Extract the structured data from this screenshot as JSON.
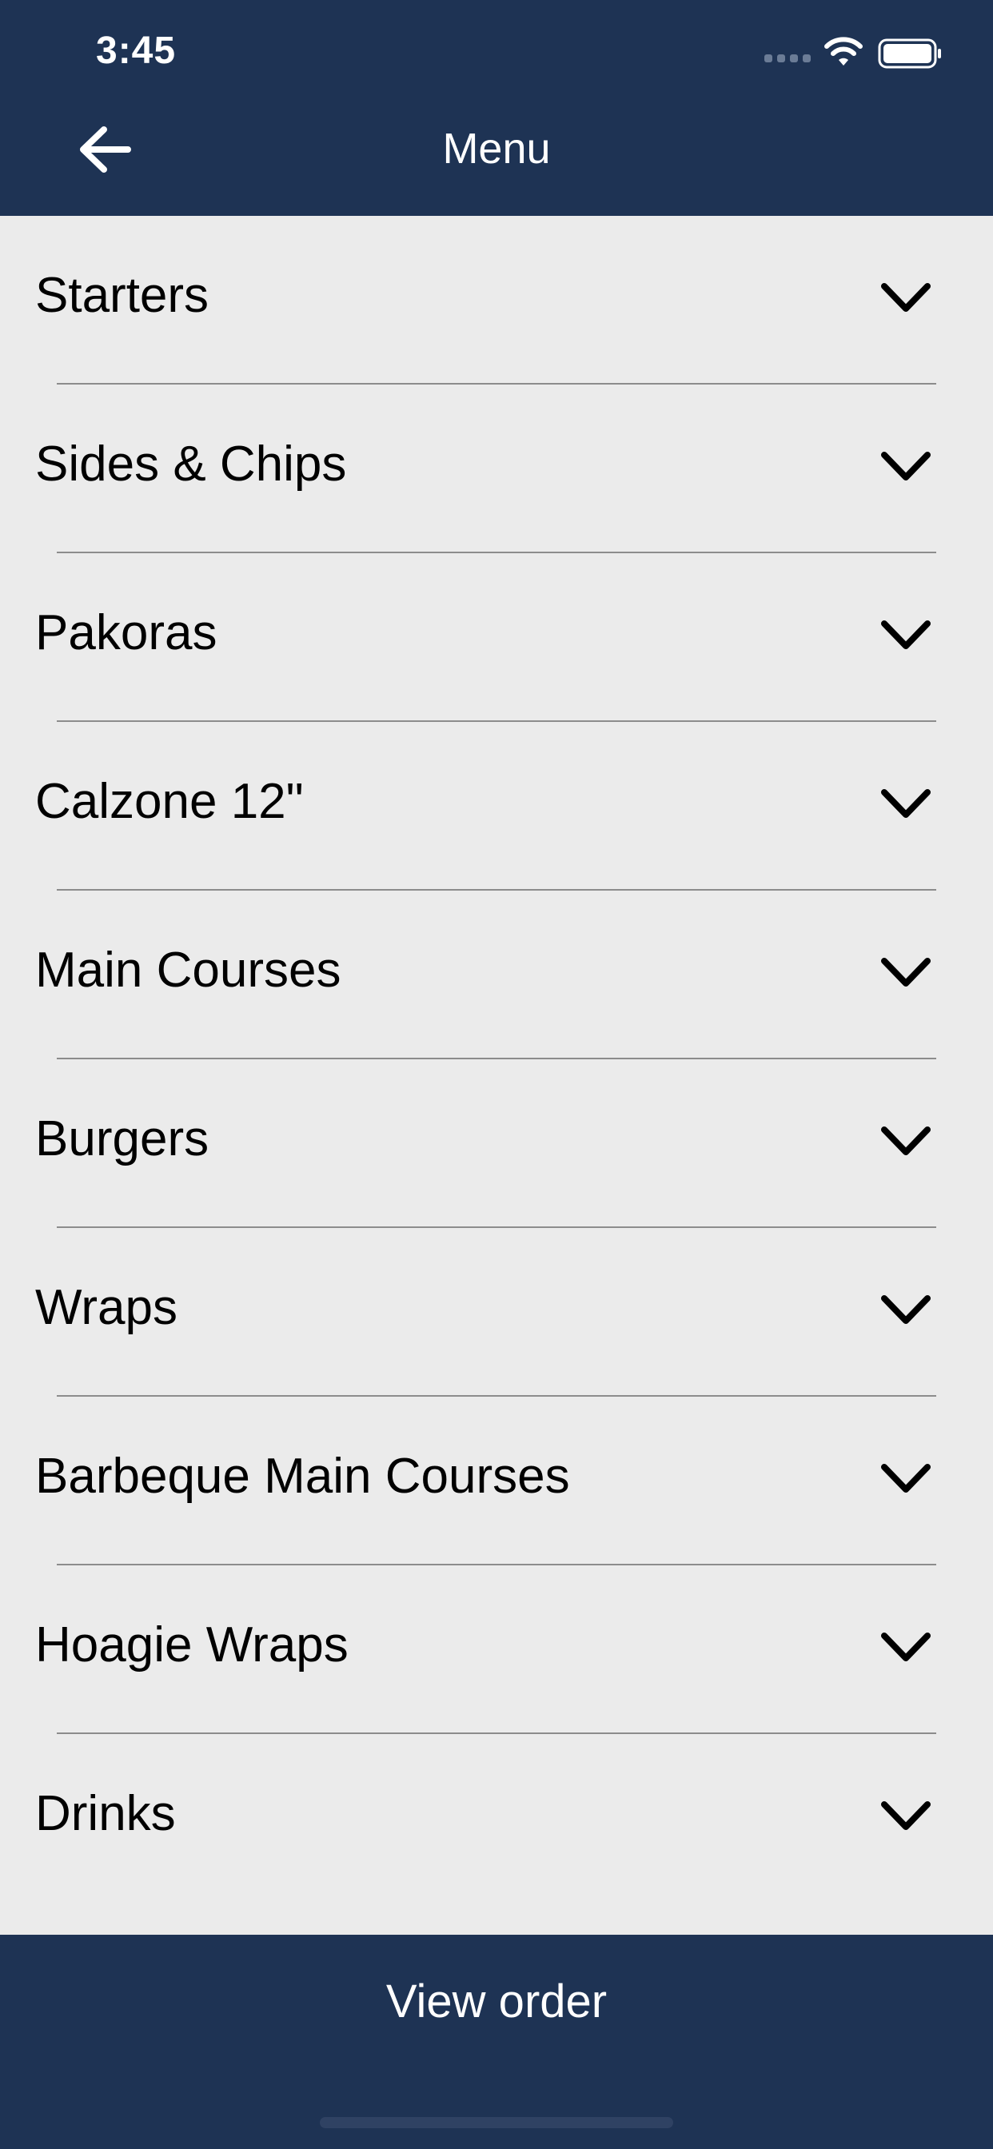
{
  "status_bar": {
    "time": "3:45"
  },
  "nav": {
    "title": "Menu",
    "back_icon": "arrow-left-icon"
  },
  "menu": {
    "items": [
      {
        "label": "Starters"
      },
      {
        "label": "Sides & Chips"
      },
      {
        "label": "Pakoras"
      },
      {
        "label": "Calzone 12\""
      },
      {
        "label": "Main Courses"
      },
      {
        "label": "Burgers"
      },
      {
        "label": "Wraps"
      },
      {
        "label": "Barbeque Main Courses"
      },
      {
        "label": "Hoagie Wraps"
      },
      {
        "label": "Drinks"
      }
    ]
  },
  "footer": {
    "view_order_label": "View order"
  },
  "colors": {
    "primary": "#1e3354",
    "background": "#ebebeb",
    "divider": "#8c8c8c",
    "text": "#000000"
  }
}
